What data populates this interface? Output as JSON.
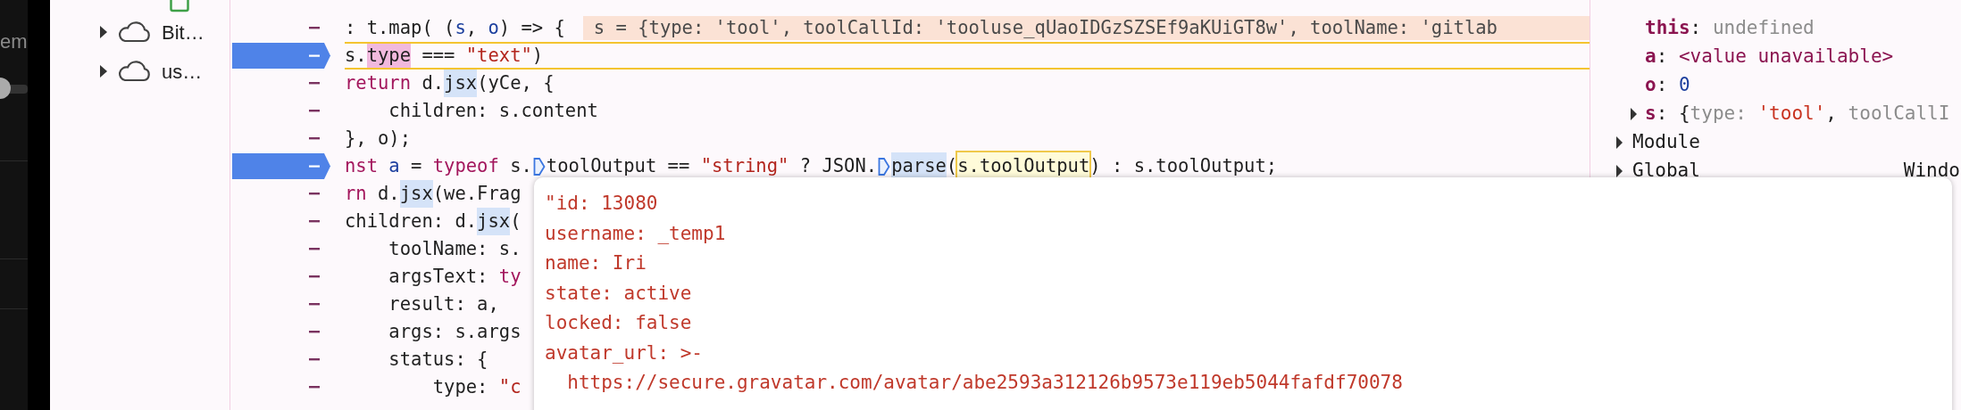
{
  "sidebar": {
    "fragment": "em",
    "toggle": {
      "on": false
    }
  },
  "tree": {
    "items": [
      {
        "label": "Bit…",
        "expanded": false
      },
      {
        "label": "us…",
        "expanded": false
      }
    ]
  },
  "code_lines": [
    {
      "breakpoint": false,
      "current": false,
      "tokens": [
        {
          "text": ": t.map( (",
          "kind": "plain"
        },
        {
          "text": "s",
          "kind": "param"
        },
        {
          "text": ", ",
          "kind": "plain"
        },
        {
          "text": "o",
          "kind": "param"
        },
        {
          "text": ") => {",
          "kind": "plain"
        }
      ],
      "inline_value": "s = {type: 'tool', toolCallId: 'tooluse_qUaoIDGzSZSEf9aKUiGT8w', toolName: 'gitlab"
    },
    {
      "breakpoint": true,
      "current": true,
      "tokens": [
        {
          "text": "s.",
          "kind": "plain"
        },
        {
          "text": "type",
          "kind": "match"
        },
        {
          "text": " === ",
          "kind": "plain"
        },
        {
          "text": "\"text\"",
          "kind": "string"
        },
        {
          "text": ")",
          "kind": "plain"
        }
      ]
    },
    {
      "breakpoint": false,
      "current": false,
      "tokens": [
        {
          "text": "return",
          "kind": "keyword"
        },
        {
          "text": " d.",
          "kind": "plain"
        },
        {
          "text": "jsx",
          "kind": "highlight"
        },
        {
          "text": "(yCe, {",
          "kind": "plain"
        }
      ]
    },
    {
      "breakpoint": false,
      "current": false,
      "tokens": [
        {
          "text": "    children: s.content",
          "kind": "plain"
        }
      ]
    },
    {
      "breakpoint": false,
      "current": false,
      "tokens": [
        {
          "text": "}, o);",
          "kind": "plain"
        }
      ]
    },
    {
      "breakpoint": true,
      "current": false,
      "tokens": [
        {
          "text": "nst",
          "kind": "keyword"
        },
        {
          "text": " a",
          "kind": "param"
        },
        {
          "text": " = ",
          "kind": "plain"
        },
        {
          "text": "typeof",
          "kind": "keyword"
        },
        {
          "text": " s.",
          "kind": "plain"
        },
        {
          "kind": "marker"
        },
        {
          "text": "toolOutput == ",
          "kind": "plain"
        },
        {
          "text": "\"string\"",
          "kind": "string"
        },
        {
          "text": " ? JSON.",
          "kind": "plain"
        },
        {
          "kind": "marker"
        },
        {
          "text": "parse",
          "kind": "highlight"
        },
        {
          "text": "(",
          "kind": "plain"
        },
        {
          "text": "s.toolOutput",
          "kind": "selection"
        },
        {
          "text": ") : s.toolOutput;",
          "kind": "plain"
        }
      ]
    },
    {
      "breakpoint": false,
      "current": false,
      "tokens": [
        {
          "text": "rn",
          "kind": "keyword"
        },
        {
          "text": " d.",
          "kind": "plain"
        },
        {
          "text": "jsx",
          "kind": "highlight"
        },
        {
          "text": "(we.Frag",
          "kind": "plain"
        }
      ]
    },
    {
      "breakpoint": false,
      "current": false,
      "tokens": [
        {
          "text": "children: d.",
          "kind": "plain"
        },
        {
          "text": "jsx",
          "kind": "highlight"
        },
        {
          "text": "(",
          "kind": "plain"
        }
      ]
    },
    {
      "breakpoint": false,
      "current": false,
      "tokens": [
        {
          "text": "    toolName: s.",
          "kind": "plain"
        }
      ]
    },
    {
      "breakpoint": false,
      "current": false,
      "tokens": [
        {
          "text": "    argsText: ",
          "kind": "plain"
        },
        {
          "text": "ty",
          "kind": "keyword"
        }
      ]
    },
    {
      "breakpoint": false,
      "current": false,
      "tokens": [
        {
          "text": "    result: a,",
          "kind": "plain"
        }
      ]
    },
    {
      "breakpoint": false,
      "current": false,
      "tokens": [
        {
          "text": "    args: s.args",
          "kind": "plain"
        }
      ]
    },
    {
      "breakpoint": false,
      "current": false,
      "tokens": [
        {
          "text": "    status: {",
          "kind": "plain"
        }
      ]
    },
    {
      "breakpoint": false,
      "current": false,
      "tokens": [
        {
          "text": "        type: ",
          "kind": "plain"
        },
        {
          "text": "\"c",
          "kind": "string"
        }
      ]
    }
  ],
  "scope": [
    {
      "kind": "property",
      "name": "this",
      "tokens": [
        {
          "text": ": ",
          "kind": "plain"
        },
        {
          "text": "undefined",
          "kind": "dim"
        }
      ]
    },
    {
      "kind": "property",
      "name": "a",
      "tokens": [
        {
          "text": ": ",
          "kind": "plain"
        },
        {
          "text": "<value unavailable>",
          "kind": "keyword"
        }
      ]
    },
    {
      "kind": "property",
      "name": "o",
      "tokens": [
        {
          "text": ": ",
          "kind": "plain"
        },
        {
          "text": "0",
          "kind": "number"
        }
      ]
    },
    {
      "kind": "property",
      "name": "s",
      "expandable": true,
      "tokens": [
        {
          "text": ": {",
          "kind": "plain"
        },
        {
          "text": "type: ",
          "kind": "dim"
        },
        {
          "text": "'tool'",
          "kind": "string"
        },
        {
          "text": ", ",
          "kind": "plain"
        },
        {
          "text": "toolCallI",
          "kind": "dim"
        }
      ]
    },
    {
      "kind": "section",
      "name": "Module"
    },
    {
      "kind": "section",
      "name": "Global",
      "value": "Windo"
    }
  ],
  "tooltip": {
    "lines": [
      "\"id: 13080",
      "username: _temp1",
      "name: Iri",
      "state: active",
      "locked: false",
      "avatar_url: >-",
      "  https://secure.gravatar.com/avatar/abe2593a312126b9573e119eb5044fafdf70078"
    ]
  }
}
